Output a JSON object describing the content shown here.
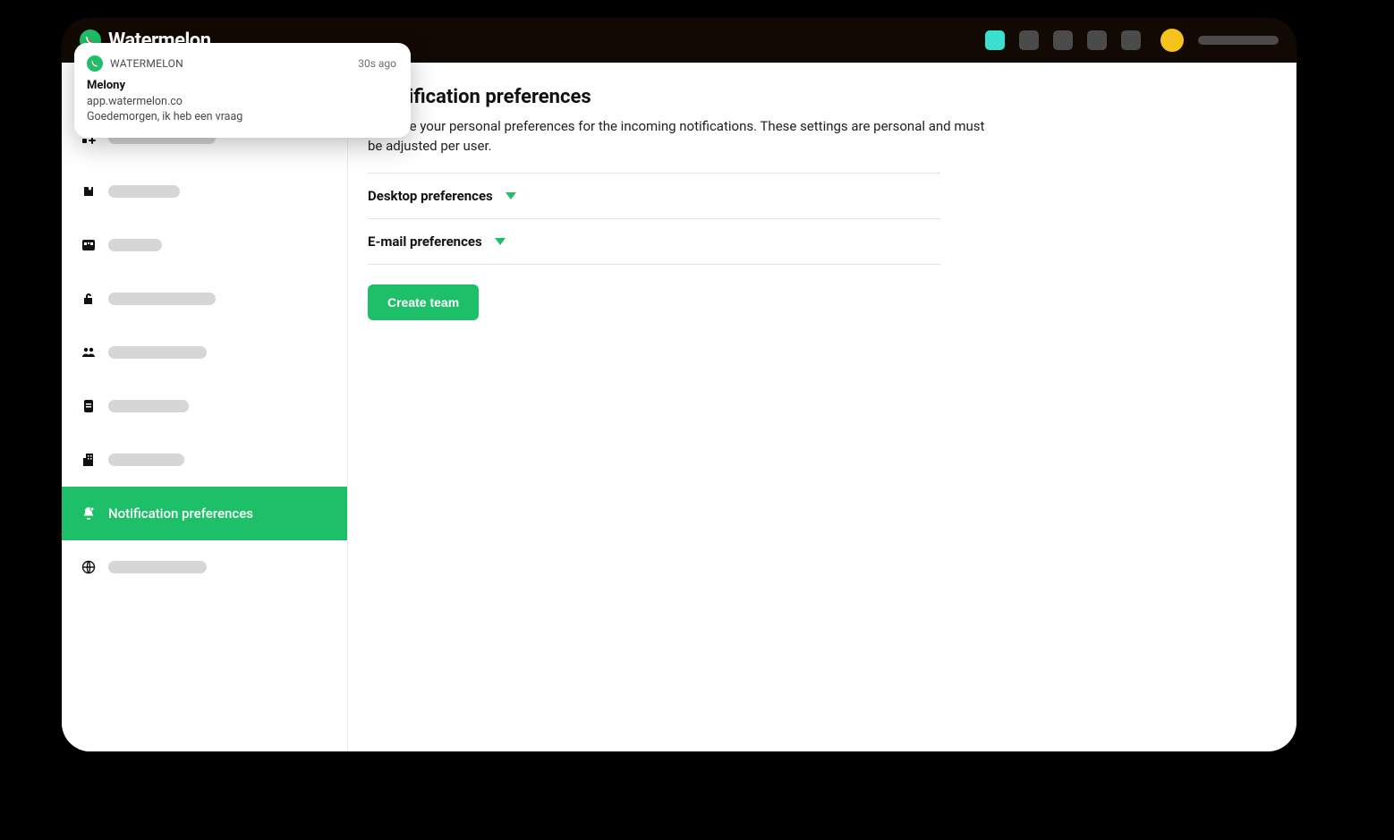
{
  "brand": {
    "name": "Watermelon"
  },
  "toast": {
    "appname": "WATERMELON",
    "time": "30s ago",
    "title": "Melony",
    "domain": "app.watermelon.co",
    "message": "Goedemorgen, ik heb een vraag"
  },
  "sidebar": {
    "active_label": "Notification preferences"
  },
  "page": {
    "title": "Notification preferences",
    "description": "Set here your personal preferences for the incoming notifications. These settings are personal and must be adjusted per user.",
    "sections": [
      {
        "label": "Desktop preferences"
      },
      {
        "label": "E-mail preferences"
      }
    ],
    "cta": "Create team"
  },
  "colors": {
    "accent": "#1dbf69",
    "teal": "#39e0d0",
    "avatar": "#f6c21c"
  }
}
